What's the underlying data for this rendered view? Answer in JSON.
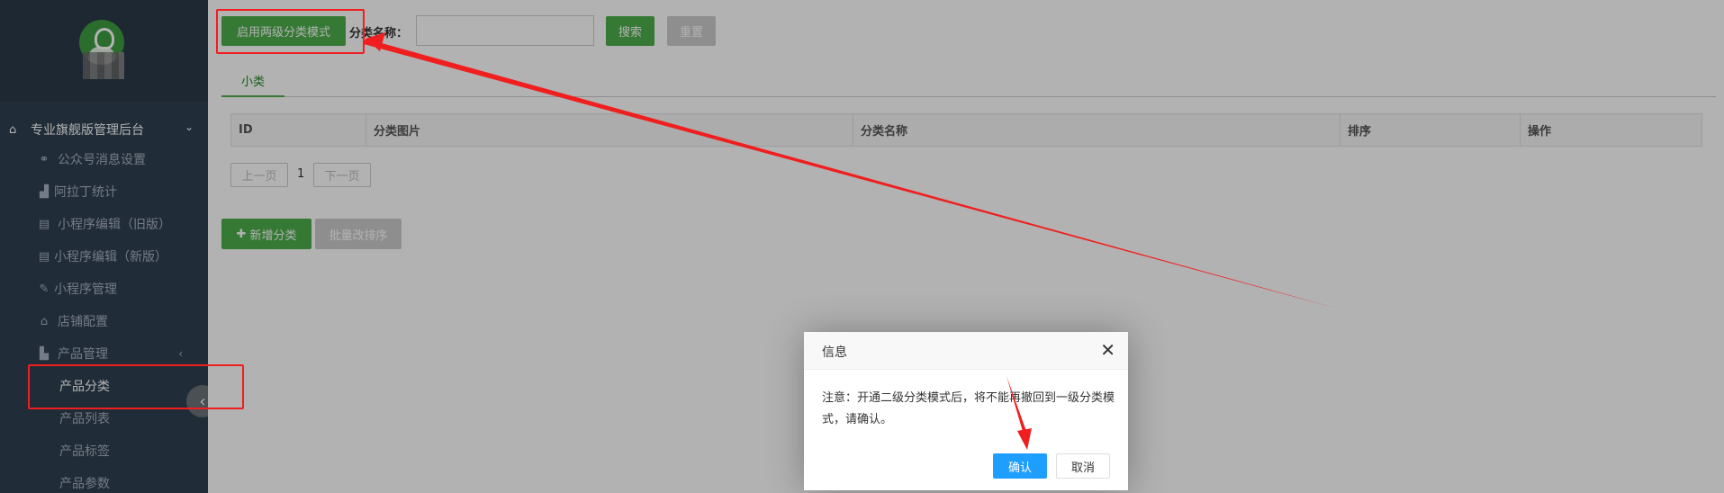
{
  "sidebar": {
    "header": {
      "label": "专业旗舰版管理后台",
      "icon": "home-icon"
    },
    "items": [
      {
        "label": "公众号消息设置",
        "icon": "link-icon"
      },
      {
        "label": "阿拉丁统计",
        "icon": "bar-chart-icon"
      },
      {
        "label": "小程序编辑（旧版）",
        "icon": "document-icon"
      },
      {
        "label": "小程序编辑（新版）",
        "icon": "document-icon"
      },
      {
        "label": "小程序管理",
        "icon": "wrench-icon"
      },
      {
        "label": "店铺配置",
        "icon": "home-icon"
      },
      {
        "label": "产品管理",
        "icon": "cart-icon"
      }
    ],
    "submenu": [
      {
        "label": "产品分类",
        "active": true
      },
      {
        "label": "产品列表"
      },
      {
        "label": "产品标签"
      },
      {
        "label": "产品参数"
      }
    ]
  },
  "toolbar": {
    "enable_two_level_label": "启用两级分类模式",
    "name_label": "分类名称：",
    "name_value": "",
    "search_label": "搜索",
    "reset_label": "重置"
  },
  "tabs": [
    {
      "label": "小类",
      "active": true
    }
  ],
  "table": {
    "columns": [
      "ID",
      "分类图片",
      "分类名称",
      "排序",
      "操作"
    ]
  },
  "pager": {
    "prev_label": "上一页",
    "page": "1",
    "next_label": "下一页"
  },
  "actions": {
    "add_label": "新增分类",
    "batch_sort_label": "批量改排序"
  },
  "dialog": {
    "title": "信息",
    "message": "注意：开通二级分类模式后，将不能再撤回到一级分类模式，请确认。",
    "ok_label": "确认",
    "cancel_label": "取消"
  },
  "colors": {
    "sidebar_bg": "#2f4050",
    "primary_green": "#4cae4c",
    "dialog_ok_blue": "#1e9fff",
    "annotation_red": "#f01e1e"
  }
}
